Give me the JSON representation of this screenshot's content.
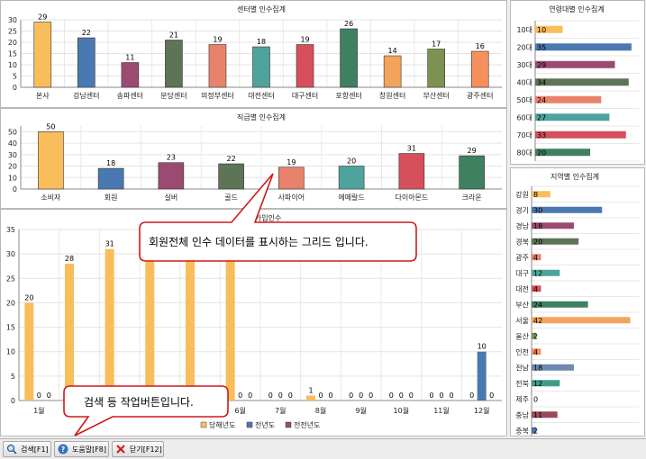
{
  "center_chart": {
    "title": "센터별 인수집계",
    "categories": [
      "본사",
      "강남센터",
      "송파센터",
      "분당센터",
      "의정부센터",
      "대전센터",
      "대구센터",
      "포항센터",
      "창원센터",
      "부산센터",
      "광주센터"
    ],
    "values": [
      29,
      22,
      11,
      21,
      19,
      18,
      19,
      26,
      14,
      17,
      16
    ],
    "colors": [
      "#f9bd5c",
      "#4a78b0",
      "#9b4a72",
      "#5e7456",
      "#e8826b",
      "#4ea49c",
      "#d5505a",
      "#3f8060",
      "#f2a35c",
      "#7c9250",
      "#f5905d"
    ],
    "ylim": [
      0,
      30
    ],
    "yticks": [
      0,
      5,
      10,
      15,
      20,
      25,
      30
    ]
  },
  "grade_chart": {
    "title": "직급별 인수집계",
    "categories": [
      "소비자",
      "회원",
      "실버",
      "골드",
      "사파이어",
      "에메랄드",
      "다이아몬드",
      "크라운"
    ],
    "values": [
      50,
      18,
      23,
      22,
      19,
      20,
      31,
      29
    ],
    "colors": [
      "#f9bd5c",
      "#4a78b0",
      "#9b4a72",
      "#5e7456",
      "#e8826b",
      "#4ea49c",
      "#d5505a",
      "#3f8060"
    ],
    "ylim": [
      0,
      55
    ],
    "yticks": [
      0,
      10,
      20,
      30,
      40,
      50
    ]
  },
  "join_chart": {
    "title": "회원 가입인수",
    "categories": [
      "1월",
      "2월",
      "3월",
      "4월",
      "5월",
      "6월",
      "7월",
      "8월",
      "9월",
      "10월",
      "11월",
      "12월"
    ],
    "series": [
      {
        "name": "당해년도",
        "color": "#f9bd5c",
        "values": [
          20,
          28,
          31,
          30,
          30,
          30,
          0,
          1,
          0,
          0,
          0,
          0
        ]
      },
      {
        "name": "전년도",
        "color": "#4a78b0",
        "values": [
          0,
          0,
          0,
          0,
          0,
          0,
          0,
          0,
          0,
          0,
          0,
          10
        ]
      },
      {
        "name": "전전년도",
        "color": "#9b4a72",
        "values": [
          0,
          0,
          0,
          0,
          0,
          0,
          0,
          0,
          0,
          0,
          0,
          0
        ]
      }
    ],
    "ylim": [
      0,
      35
    ],
    "yticks": [
      0,
      5,
      10,
      15,
      20,
      25,
      30,
      35
    ]
  },
  "age_chart": {
    "title": "연령대별 인수집계",
    "categories": [
      "10대",
      "20대",
      "30대",
      "40대",
      "50대",
      "60대",
      "70대",
      "80대"
    ],
    "values": [
      10,
      35,
      29,
      34,
      24,
      27,
      33,
      20
    ],
    "colors": [
      "#f9bd5c",
      "#4a78b0",
      "#9b4a72",
      "#5e7456",
      "#e8826b",
      "#4ea49c",
      "#d5505a",
      "#3f8060"
    ],
    "xmax": 38
  },
  "region_chart": {
    "title": "지역별 인수집계",
    "categories": [
      "강원",
      "경기",
      "경남",
      "경북",
      "광주",
      "대구",
      "대전",
      "부산",
      "서울",
      "울산",
      "인천",
      "전남",
      "전북",
      "제주",
      "충남",
      "충북"
    ],
    "values": [
      8,
      30,
      18,
      20,
      4,
      12,
      4,
      24,
      42,
      2,
      4,
      18,
      12,
      0,
      11,
      2
    ],
    "colors": [
      "#f9bd5c",
      "#4a78b0",
      "#9b4a72",
      "#5e7456",
      "#e8826b",
      "#4ea49c",
      "#d5505a",
      "#3f8060",
      "#f2a35c",
      "#7c9250",
      "#f5905d",
      "#6c8ab0",
      "#3e9c8a",
      "#c8c8c8",
      "#9b4a5a",
      "#4a78b0"
    ],
    "xmax": 46
  },
  "callouts": {
    "grid_note": "회원전체 인수 데이터를 표시하는 그리드 입니다.",
    "toolbar_note": "검색 등 작업버튼입니다."
  },
  "toolbar": {
    "search_label": "검색[F1]",
    "help_label": "도움말[F8]",
    "close_label": "닫기[F12]"
  }
}
